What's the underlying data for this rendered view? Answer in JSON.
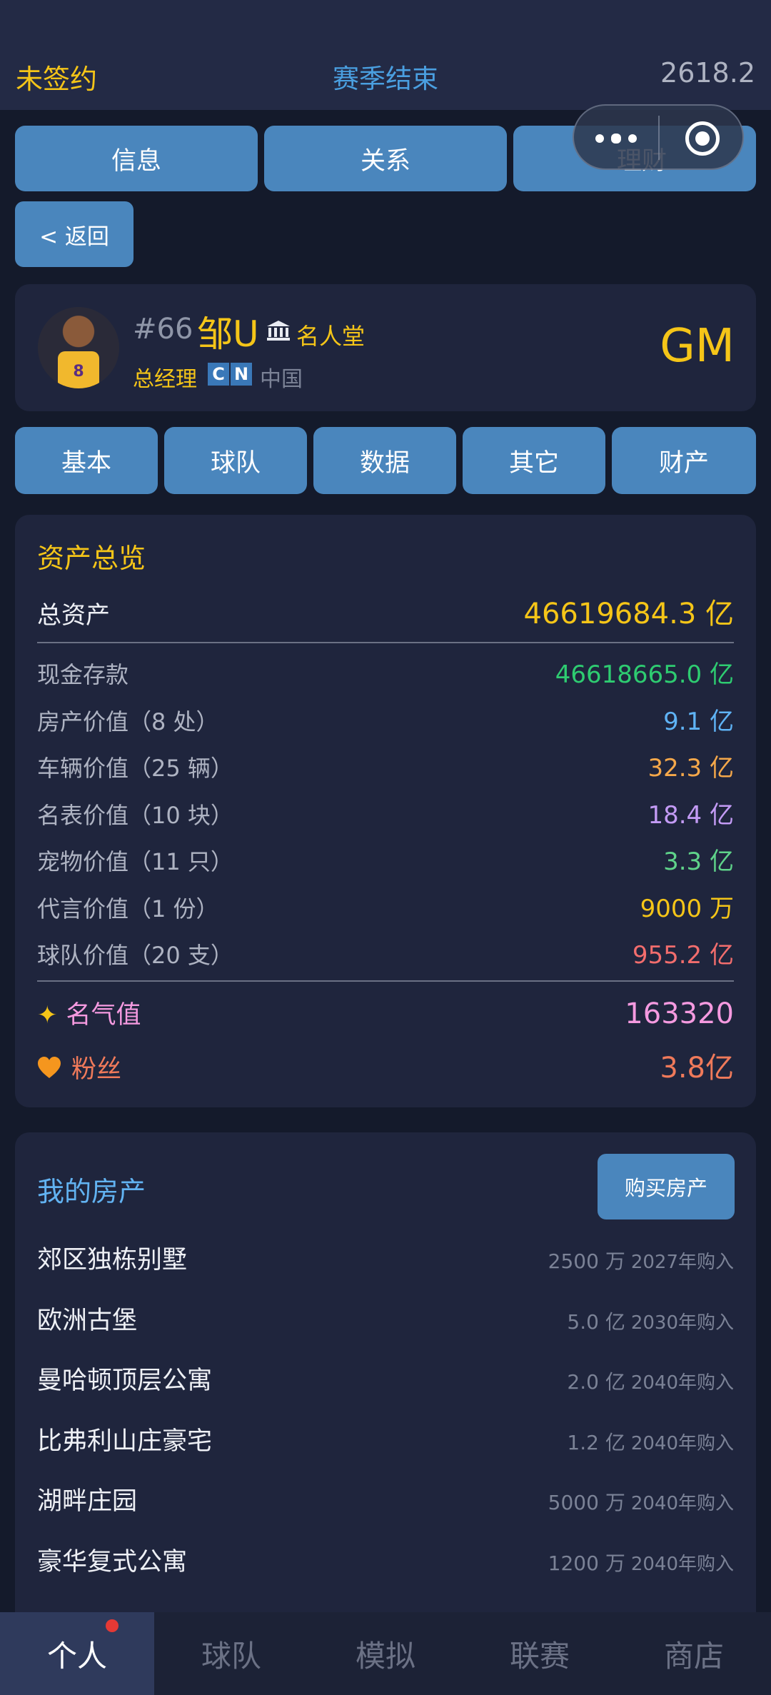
{
  "header": {
    "status_left": "未签约",
    "season": "赛季结束",
    "balance": "2618.2"
  },
  "top_tabs": [
    "信息",
    "关系",
    "理财"
  ],
  "back_label": "< 返回",
  "profile": {
    "number": "#66",
    "name": "邹U",
    "hall_of_fame": "名人堂",
    "role": "总经理",
    "flag_letters": [
      "C",
      "N"
    ],
    "country": "中国",
    "badge": "GM"
  },
  "sub_tabs": [
    "基本",
    "球队",
    "数据",
    "其它",
    "财产"
  ],
  "assets": {
    "title": "资产总览",
    "total": {
      "label": "总资产",
      "value": "46619684.3 亿",
      "color": "#f5c518"
    },
    "items": [
      {
        "label": "现金存款",
        "value": "46618665.0 亿",
        "color": "#2ecc71"
      },
      {
        "label": "房产价值（8 处）",
        "value": "9.1 亿",
        "color": "#5fb3f5"
      },
      {
        "label": "车辆价值（25 辆）",
        "value": "32.3 亿",
        "color": "#f5a84a"
      },
      {
        "label": "名表价值（10 块）",
        "value": "18.4 亿",
        "color": "#c39bf5"
      },
      {
        "label": "宠物价值（11 只）",
        "value": "3.3 亿",
        "color": "#5fd38a"
      },
      {
        "label": "代言价值（1 份）",
        "value": "9000 万",
        "color": "#f5c518"
      },
      {
        "label": "球队价值（20 支）",
        "value": "955.2 亿",
        "color": "#f26d6d"
      }
    ],
    "fame": {
      "label": "名气值",
      "value": "163320",
      "color": "#f59ae0"
    },
    "fans": {
      "label": "粉丝",
      "value": "3.8亿",
      "color": "#f07a5a"
    }
  },
  "properties": {
    "title": "我的房产",
    "buy_label": "购买房产",
    "items": [
      {
        "name": "郊区独栋别墅",
        "price": "2500 万",
        "year": "2027年购入"
      },
      {
        "name": "欧洲古堡",
        "price": "5.0 亿",
        "year": "2030年购入"
      },
      {
        "name": "曼哈顿顶层公寓",
        "price": "2.0 亿",
        "year": "2040年购入"
      },
      {
        "name": "比弗利山庄豪宅",
        "price": "1.2 亿",
        "year": "2040年购入"
      },
      {
        "name": "湖畔庄园",
        "price": "5000 万",
        "year": "2040年购入"
      },
      {
        "name": "豪华复式公寓",
        "price": "1200 万",
        "year": "2040年购入"
      }
    ]
  },
  "bottom_nav": [
    "个人",
    "球队",
    "模拟",
    "联赛",
    "商店"
  ]
}
